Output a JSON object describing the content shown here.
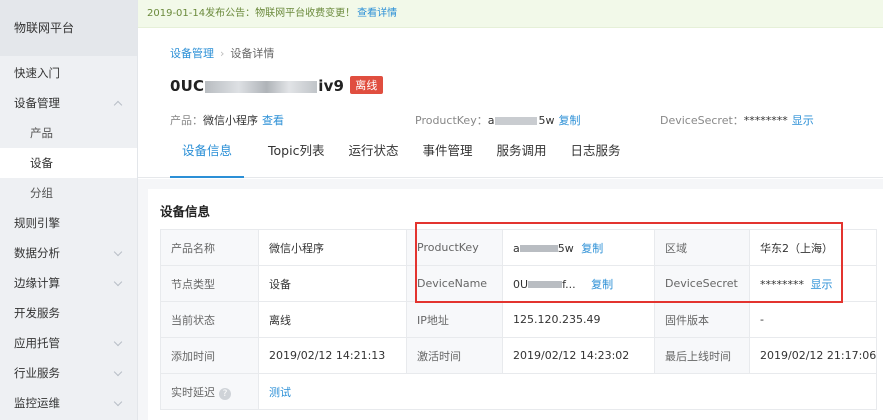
{
  "sidebar": {
    "brand": "物联网平台",
    "items": [
      {
        "label": "快速入门"
      },
      {
        "label": "设备管理"
      },
      {
        "label": "产品"
      },
      {
        "label": "设备"
      },
      {
        "label": "分组"
      },
      {
        "label": "规则引擎"
      },
      {
        "label": "数据分析"
      },
      {
        "label": "边缘计算"
      },
      {
        "label": "开发服务"
      },
      {
        "label": "应用托管"
      },
      {
        "label": "行业服务"
      },
      {
        "label": "监控运维"
      }
    ]
  },
  "notice": {
    "text": "2019-01-14发布公告：物联网平台收费变更！",
    "link": "查看详情"
  },
  "breadcrumb": {
    "parent": "设备管理",
    "separator": "›",
    "current": "设备详情"
  },
  "device": {
    "name_prefix": "0UC",
    "name_suffix": "iv9",
    "status_badge": "离线"
  },
  "meta": {
    "product_label": "产品：",
    "product_value": "微信小程序",
    "product_link": "查看",
    "productkey_label": "ProductKey：",
    "productkey_prefix": "a",
    "productkey_suffix": "5w",
    "productkey_copy": "复制",
    "secret_label": "DeviceSecret：",
    "secret_value": "********",
    "secret_show": "显示"
  },
  "tabs": [
    "设备信息",
    "Topic列表",
    "运行状态",
    "事件管理",
    "服务调用",
    "日志服务"
  ],
  "section_title": "设备信息",
  "info_rows": [
    {
      "k1": "产品名称",
      "v1": "微信小程序",
      "k2": "ProductKey",
      "v2_prefix": "a",
      "v2_suffix": "5w",
      "v2_link": "复制",
      "k3": "区域",
      "v3": "华东2（上海）"
    },
    {
      "k1": "节点类型",
      "v1": "设备",
      "k2": "DeviceName",
      "v2_prefix": "0U",
      "v2_suffix": "f...",
      "v2_link": "复制",
      "k3": "DeviceSecret",
      "v3": "********",
      "v3_link": "显示"
    },
    {
      "k1": "当前状态",
      "v1": "离线",
      "k2": "IP地址",
      "v2": "125.120.235.49",
      "k3": "固件版本",
      "v3": "-"
    },
    {
      "k1": "添加时间",
      "v1": "2019/02/12 14:21:13",
      "k2": "激活时间",
      "v2": "2019/02/12 14:23:02",
      "k3": "最后上线时间",
      "v3": "2019/02/12 21:17:06"
    },
    {
      "k1": "实时延迟",
      "v1_link": "测试"
    }
  ]
}
